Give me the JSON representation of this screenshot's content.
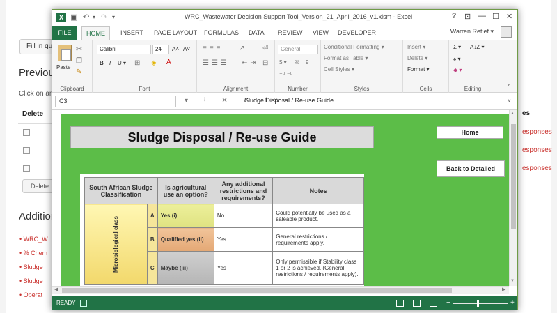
{
  "bg": {
    "fill_button": "Fill in que",
    "previous_heading": "Previous",
    "click_text": "Click on an",
    "table_header_delete": "Delete",
    "delete_button": "Delete",
    "additional_heading": "Addition",
    "links": [
      "WRC_W",
      "% Chem",
      "Sludge",
      "Sludge",
      "Operat"
    ],
    "right_header": "es",
    "right_links": [
      "esponses",
      "esponses",
      "esponses"
    ]
  },
  "excel": {
    "title": "WRC_Wastewater Decision Support Tool_Version_21_April_2016_v1.xlsm - Excel",
    "window_controls": [
      "?",
      "⊡",
      "—",
      "☐",
      "✕"
    ],
    "tabs": [
      "FILE",
      "HOME",
      "INSERT",
      "PAGE LAYOUT",
      "FORMULAS",
      "DATA",
      "REVIEW",
      "VIEW",
      "DEVELOPER"
    ],
    "active_tab": "HOME",
    "user": "Warren Retief ▾",
    "ribbon": {
      "clipboard": {
        "label": "Clipboard",
        "paste": "Paste"
      },
      "font": {
        "label": "Font",
        "name": "Calibri",
        "size": "24",
        "grow": "A˄",
        "shrink": "A˅",
        "bold": "B",
        "italic": "I",
        "underline": "U ▾"
      },
      "alignment": {
        "label": "Alignment"
      },
      "number": {
        "label": "Number",
        "format": "General",
        "currency": "$ ▾",
        "percent": "%",
        "comma": "9"
      },
      "styles": {
        "label": "Styles",
        "conditional": "Conditional Formatting ▾",
        "table": "Format as Table ▾",
        "cell_styles": "Cell Styles ▾"
      },
      "cells": {
        "label": "Cells",
        "insert": "Insert ▾",
        "delete": "Delete ▾",
        "format": "Format ▾"
      },
      "editing": {
        "label": "Editing",
        "sum": "Σ ▾",
        "sort": "A↓Z ▾",
        "find": "♠ ▾",
        "clear": "◆ ▾"
      }
    },
    "name_box": "C3",
    "formula_icons": "▾ ⁞ ✕ ✓ fx",
    "formula": "Sludge Disposal / Re-use Guide",
    "status": "READY"
  },
  "sheet": {
    "title": "Sludge Disposal / Re-use Guide",
    "home_button": "Home",
    "back_button": "Back to Detailed",
    "table": {
      "headers": [
        "South African Sludge Classification",
        "Is agricultural use an option?",
        "Any additional restrictions and requirements?",
        "Notes"
      ],
      "micro_label": "Microbiological class",
      "rows": [
        {
          "cls": "A",
          "agri": "Yes (i)",
          "restrict": "No",
          "notes": "Could potentially be used as a saleable product."
        },
        {
          "cls": "B",
          "agri": "Qualified yes (ii)",
          "restrict": "Yes",
          "notes": "General restrictions / requirements apply."
        },
        {
          "cls": "C",
          "agri": "Maybe (iii)",
          "restrict": "Yes",
          "notes": "Only permissible if Stability class 1 or 2 is achieved. (General restrictions / requirements apply)."
        }
      ]
    }
  },
  "colors": {
    "excel_green": "#217346",
    "sheet_green": "#5cbd48",
    "link_red": "#c9302c"
  }
}
